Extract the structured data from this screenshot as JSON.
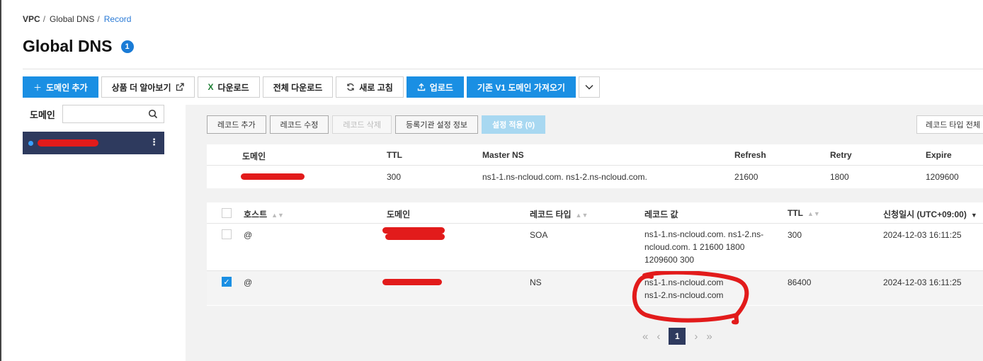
{
  "breadcrumb": {
    "items": [
      "VPC",
      "Global DNS"
    ],
    "current": "Record",
    "separator": "/"
  },
  "page": {
    "title": "Global DNS",
    "badge": "1"
  },
  "toolbar": {
    "add_domain": "도메인 추가",
    "learn_more": "상품 더 알아보기",
    "download": "다운로드",
    "download_all": "전체 다운로드",
    "refresh": "새로 고침",
    "upload": "업로드",
    "import_v1": "기존 V1 도메인 가져오기"
  },
  "sidebar": {
    "search_label": "도메인",
    "search_value": ""
  },
  "record_toolbar": {
    "add": "레코드 추가",
    "edit": "레코드 수정",
    "delete": "레코드 삭제",
    "registrar": "등록기관 설정 정보",
    "apply": "설정 적용 (0)",
    "type_filter": "레코드 타입 전체"
  },
  "soa_table": {
    "headers": [
      "도메인",
      "TTL",
      "Master NS",
      "Refresh",
      "Retry",
      "Expire"
    ],
    "row": {
      "ttl": "300",
      "master_ns": "ns1-1.ns-ncloud.com. ns1-2.ns-ncloud.com.",
      "refresh": "21600",
      "retry": "1800",
      "expire": "1209600"
    }
  },
  "record_table": {
    "headers": {
      "host": "호스트",
      "domain": "도메인",
      "type": "레코드 타입",
      "value": "레코드 값",
      "ttl": "TTL",
      "created": "신청일시 (UTC+09:00)"
    },
    "rows": [
      {
        "checked": false,
        "host": "@",
        "type": "SOA",
        "value": "ns1-1.ns-ncloud.com. ns1-2.ns-ncloud.com. 1 21600 1800 1209600 300",
        "ttl": "300",
        "created": "2024-12-03 16:11:25"
      },
      {
        "checked": true,
        "host": "@",
        "type": "NS",
        "value_line1": "ns1-1.ns-ncloud.com",
        "value_line2": "ns1-2.ns-ncloud.com",
        "ttl": "86400",
        "created": "2024-12-03 16:11:25"
      }
    ]
  },
  "pagination": {
    "current": "1"
  },
  "colors": {
    "primary": "#1a8fe3",
    "nav_dark": "#2e3a5e",
    "redaction": "#e21b1b",
    "link": "#2b7bd6"
  }
}
